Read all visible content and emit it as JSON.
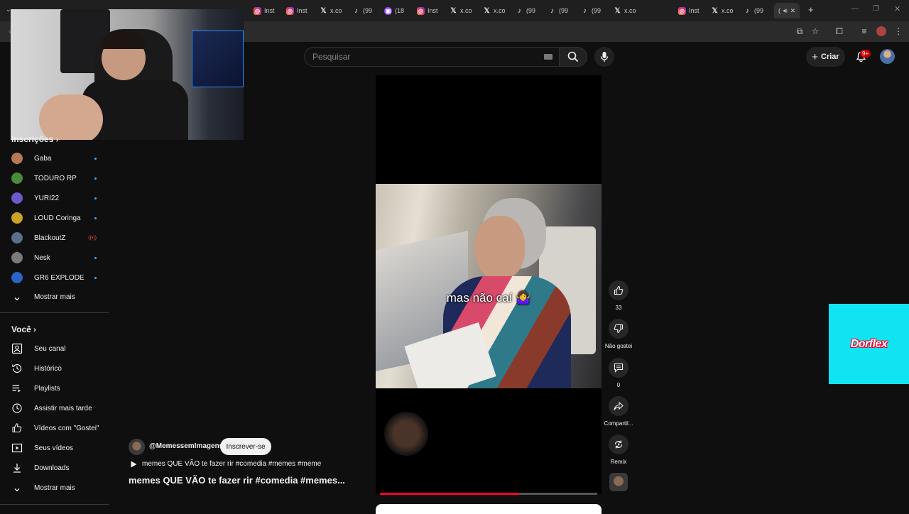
{
  "browser": {
    "tabs": [
      {
        "icon": "instagram-icon",
        "label": "Inst"
      },
      {
        "icon": "instagram-icon",
        "label": "Inst"
      },
      {
        "icon": "x-icon",
        "label": "x.co"
      },
      {
        "icon": "tiktok-icon",
        "label": "(99"
      },
      {
        "icon": "twitch-icon",
        "label": "(18"
      },
      {
        "icon": "instagram-icon",
        "label": "Inst"
      },
      {
        "icon": "x-icon",
        "label": "x.co"
      },
      {
        "icon": "x-icon",
        "label": "x.co"
      },
      {
        "icon": "tiktok-icon",
        "label": "(99"
      },
      {
        "icon": "tiktok-icon",
        "label": "(99"
      },
      {
        "icon": "tiktok-icon",
        "label": "(99"
      },
      {
        "icon": "x-icon",
        "label": "x.co"
      },
      {
        "icon": "instagram-icon",
        "label": "Inst"
      },
      {
        "icon": "x-icon",
        "label": "x.co"
      },
      {
        "icon": "tiktok-icon",
        "label": "(99"
      }
    ],
    "active_tab": {
      "label": "("
    }
  },
  "header": {
    "search_placeholder": "Pesquisar",
    "create_label": "Criar",
    "notifications_badge": "9+"
  },
  "sidebar": {
    "subscriptions_title": "Inscrições",
    "subscriptions": [
      {
        "name": "Gaba",
        "color": "#b87a55",
        "status": "new"
      },
      {
        "name": "TODURO RP",
        "color": "#4a8a3c",
        "status": "new"
      },
      {
        "name": "YURI22",
        "color": "#6a5acd",
        "status": "new"
      },
      {
        "name": "LOUD Coringa",
        "color": "#c9a227",
        "status": "new"
      },
      {
        "name": "BlackoutZ",
        "color": "#5a6f8a",
        "status": "live"
      },
      {
        "name": "Nesk",
        "color": "#7a7a7a",
        "status": "new"
      },
      {
        "name": "GR6 EXPLODE",
        "color": "#2a64c8",
        "status": "new"
      }
    ],
    "subs_show_more": "Mostrar mais",
    "you_title": "Você",
    "you_items": [
      {
        "icon": "channel-icon",
        "label": "Seu canal"
      },
      {
        "icon": "history-icon",
        "label": "Histórico"
      },
      {
        "icon": "playlists-icon",
        "label": "Playlists"
      },
      {
        "icon": "watch-later-icon",
        "label": "Assistir mais tarde"
      },
      {
        "icon": "liked-icon",
        "label": "Vídeos com \"Gostei\""
      },
      {
        "icon": "your-videos-icon",
        "label": "Seus vídeos"
      },
      {
        "icon": "downloads-icon",
        "label": "Downloads"
      }
    ],
    "you_show_more": "Mostrar mais"
  },
  "video": {
    "caption": "mas não caí 🤷‍♀️",
    "progress": 0.64
  },
  "actions": {
    "like_count": "33",
    "dislike_label": "Não gostei",
    "comment_count": "0",
    "share_label": "Compartil...",
    "remix_label": "Remix"
  },
  "channel": {
    "name": "@MemessemImagens",
    "subscribe_label": "Inscrever-se",
    "linked_short": "memes QUE VÃO te fazer rir #comedia #memes #meme",
    "title": "memes QUE VÃO te fazer rir #comedia #memes..."
  },
  "ad": {
    "brand": "Dorflex"
  }
}
